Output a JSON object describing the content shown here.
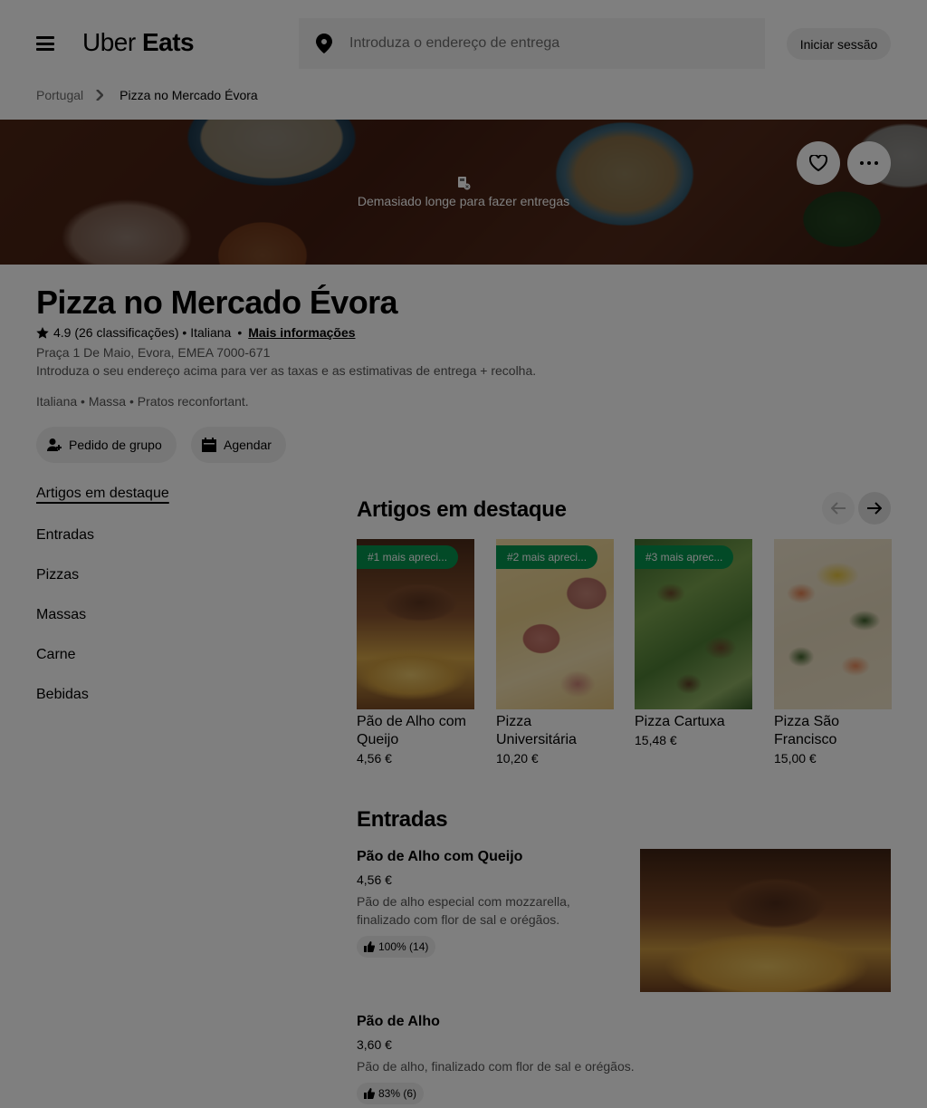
{
  "header": {
    "brand_regular": "Uber",
    "brand_bold": "Eats",
    "search_placeholder": "Introduza o endereço de entrega",
    "signin_label": "Iniciar sessão"
  },
  "breadcrumb": {
    "items": [
      "Portugal",
      "Pizza no Mercado Évora"
    ]
  },
  "hero": {
    "delivery_message": "Demasiado longe para fazer entregas"
  },
  "store": {
    "name": "Pizza no Mercado Évora",
    "rating": "4.9",
    "rating_count": "(26 classificações)",
    "category": "Italiana",
    "more_info": "Mais informações",
    "address": "Praça 1 De Maio, Evora, EMEA 7000-671",
    "hint": "Introduza o seu endereço acima para ver as taxas e as estimativas de entrega + recolha.",
    "tags": "Italiana • Massa • Pratos reconfortant."
  },
  "actions": {
    "group_order": "Pedido de grupo",
    "schedule": "Agendar"
  },
  "menu_nav": [
    "Artigos em destaque",
    "Entradas",
    "Pizzas",
    "Massas",
    "Carne",
    "Bebidas"
  ],
  "featured": {
    "title": "Artigos em destaque",
    "items": [
      {
        "badge": "#1 mais apreci...",
        "name": "Pão de Alho com Queijo",
        "price": "4,56 €"
      },
      {
        "badge": "#2 mais apreci...",
        "name": "Pizza Universitária",
        "price": "10,20 €"
      },
      {
        "badge": "#3 mais aprec...",
        "name": "Pizza Cartuxa",
        "price": "15,48 €"
      },
      {
        "badge": "",
        "name": "Pizza São Francisco",
        "price": "15,00 €"
      }
    ]
  },
  "entradas": {
    "title": "Entradas",
    "items": [
      {
        "name": "Pão de Alho com Queijo",
        "price": "4,56 €",
        "description": "Pão de alho especial com mozzarella, finalizado com flor de sal e orégãos.",
        "rating": "100% (14)"
      },
      {
        "name": "Pão de Alho",
        "price": "3,60 €",
        "description": "Pão de alho, finalizado com flor de sal e orégãos.",
        "rating": "83% (6)"
      }
    ]
  },
  "colors": {
    "badge_green": "#05944f",
    "overlay": "rgba(0,0,0,0.5)"
  },
  "icons": [
    "menu-icon",
    "location-pin-icon",
    "chevron-right-icon",
    "no-delivery-icon",
    "heart-icon",
    "more-icon",
    "star-icon",
    "add-person-icon",
    "calendar-icon",
    "arrow-left-icon",
    "arrow-right-icon",
    "thumbs-up-icon"
  ]
}
